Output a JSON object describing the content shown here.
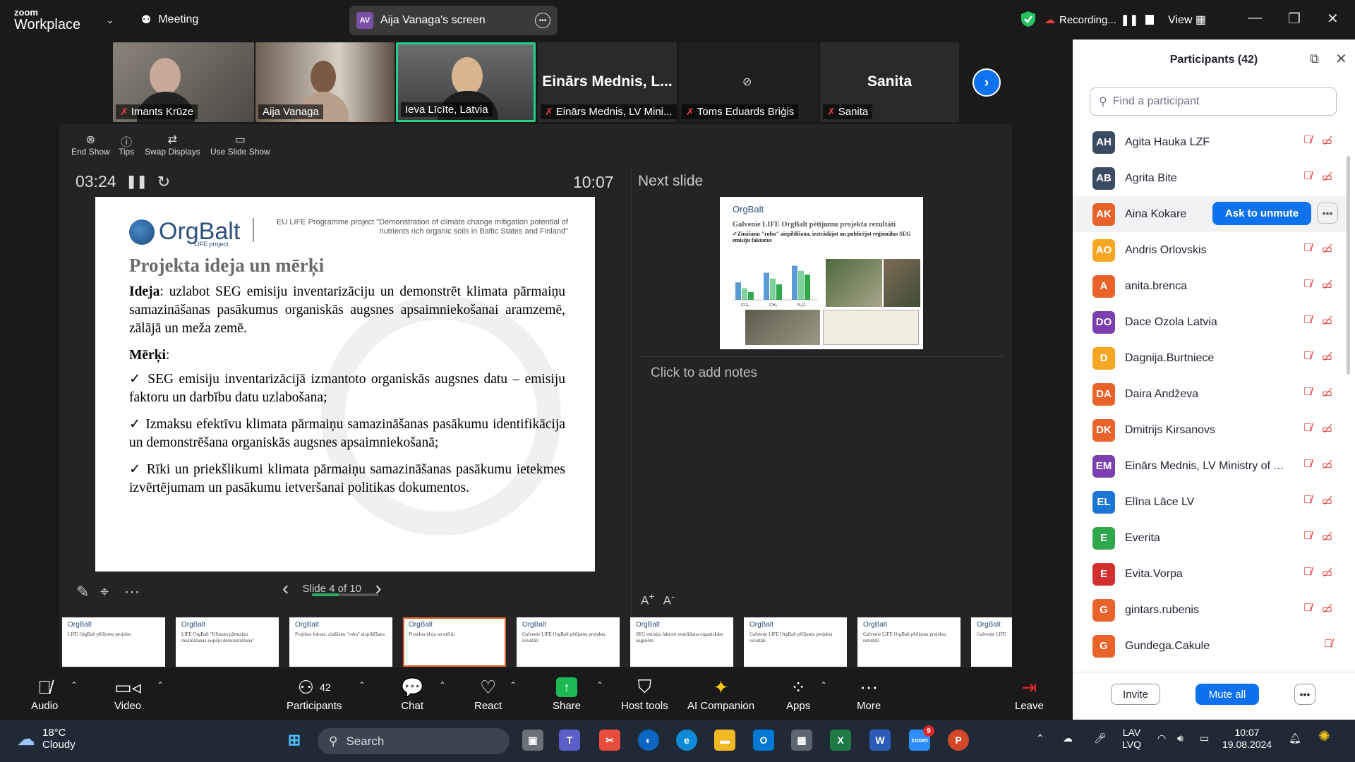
{
  "app": {
    "logo_small": "zoom",
    "logo_big": "Workplace",
    "meeting_label": "Meeting",
    "share_initials": "AV",
    "share_label": "Aija Vanaga's screen",
    "recording_label": "Recording...",
    "view_label": "View"
  },
  "gallery": [
    {
      "name": "Imants Krūze",
      "muted": true,
      "video": true
    },
    {
      "name": "Aija Vanaga",
      "muted": false,
      "video": true
    },
    {
      "name": "Ieva Līcīte, Latvia",
      "muted": false,
      "video": true,
      "active": true
    },
    {
      "name": "Einārs Mednis, LV Mini...",
      "big": "Einārs Mednis, L...",
      "muted": true,
      "video": false
    },
    {
      "name": "Toms Eduards Briģis",
      "muted": true,
      "video": false,
      "cam_off": true
    },
    {
      "name": "Sanita",
      "big": "Sanita",
      "muted": true,
      "video": false
    }
  ],
  "presenter": {
    "tools": [
      "End Show",
      "Tips",
      "Swap Displays",
      "Use Slide Show"
    ],
    "timer": "03:24",
    "clock": "10:07",
    "next_label": "Next slide",
    "notes_placeholder": "Click to add notes",
    "slide_counter": "Slide 4 of 10",
    "progress": 0.4
  },
  "slide": {
    "logo_text": "OrgBalt",
    "logo_sub": "LIFE project",
    "program": "EU LIFE Programme project \"Demonstration of climate change mitigation potential of nutrients rich organic soils in Baltic States and Finland\"",
    "title": "Projekta ideja un mērķi",
    "idea_label": "Ideja",
    "idea_text": ": uzlabot SEG emisiju inventarizāciju un demonstrēt klimata pārmaiņu samazināšanas pasākumus organiskās augsnes apsaimniekošanai aramzemē, zālājā un meža zemē.",
    "goals_label": "Mērķi",
    "goals": [
      "SEG emisiju inventarizācijā izmantoto organiskās augsnes datu – emisiju faktoru un darbību datu uzlabošana;",
      "Izmaksu efektīvu klimata pārmaiņu samazināšanas pasākumu identifikācija un demonstrēšana organiskās augsnes apsaimniekošanā;",
      "Rīki un priekšlikumi klimata pārmaiņu samazināšanas pasākumu ietekmes izvērtējumam un pasākumu ietveršanai politikas dokumentos."
    ]
  },
  "next_slide": {
    "logo_text": "OrgBalt",
    "title": "Galvenie LIFE OrgBalt pētījumu projekta rezultāti",
    "bullet": "✓Zināšanu \"robu\" aizpildīšana, izstrādājot un publicējot reģionālus SEG emisiju faktorus",
    "chart_labels": [
      "CO₂",
      "CH₄",
      "N₂O"
    ],
    "chart_values": [
      [
        45,
        70,
        88
      ],
      [
        30,
        55,
        75
      ],
      [
        20,
        40,
        65
      ]
    ]
  },
  "thumbnails": [
    "LIFE OrgBalt pētījumu projekts",
    "LIFE OrgBalt \"Klimata pārmaiņu mazināšanas iespēju demonstrēšana\"",
    "Projekta fokuss: zināšanu \"robu\" aizpildīšana",
    "Projekta ideja un mērķi",
    "Galvenie LIFE OrgBalt pētījumu projekta rezultāti",
    "SEG emisiju faktoru noteikšana organiskām augsnēm",
    "Galvenie LIFE OrgBalt pētījumu projekta rezultāti",
    "Galvenie LIFE OrgBalt pētījumu projekta rezultāti",
    "Galvenie LIFE"
  ],
  "participants": {
    "title": "Participants (42)",
    "search_placeholder": "Find a participant",
    "ask_unmute": "Ask to unmute",
    "list": [
      {
        "initials": "AH",
        "name": "Agita Hauka LZF",
        "color": "#3b4a63"
      },
      {
        "initials": "AB",
        "name": "Agrita Bite",
        "color": "#3b4a63"
      },
      {
        "initials": "AK",
        "name": "Aina Kokare",
        "color": "#e8622a",
        "highlight": true
      },
      {
        "initials": "AO",
        "name": "Andris Orlovskis",
        "color": "#f5a623"
      },
      {
        "initials": "A",
        "name": "anita.brenca",
        "color": "#e8622a"
      },
      {
        "initials": "DO",
        "name": "Dace Ozola Latvia",
        "color": "#7b3fb0"
      },
      {
        "initials": "D",
        "name": "Dagnija.Burtniece",
        "color": "#f5a623"
      },
      {
        "initials": "DA",
        "name": "Daira Andževa",
        "color": "#e8622a"
      },
      {
        "initials": "DK",
        "name": "Dmitrijs Kirsanovs",
        "color": "#e8622a"
      },
      {
        "initials": "EM",
        "name": "Einārs Mednis, LV Ministry of Ag...",
        "color": "#7b3fb0"
      },
      {
        "initials": "EL",
        "name": "Elīna Lāce LV",
        "color": "#1976d2"
      },
      {
        "initials": "E",
        "name": "Everita",
        "color": "#2ea84a"
      },
      {
        "initials": "E",
        "name": "Evita.Vorpa",
        "color": "#d32f2f"
      },
      {
        "initials": "G",
        "name": "gintars.rubenis",
        "color": "#e8622a"
      },
      {
        "initials": "G",
        "name": "Gundega.Cakule",
        "color": "#e8622a",
        "no_video_icon": true
      }
    ],
    "invite": "Invite",
    "mute_all": "Mute all"
  },
  "controls": {
    "audio": "Audio",
    "video": "Video",
    "participants": "Participants",
    "participants_count": "42",
    "chat": "Chat",
    "react": "React",
    "share": "Share",
    "host_tools": "Host tools",
    "ai": "AI Companion",
    "apps": "Apps",
    "more": "More",
    "leave": "Leave"
  },
  "taskbar": {
    "temp": "18°C",
    "weather": "Cloudy",
    "search": "Search",
    "lang1": "LAV",
    "lang2": "LVQ",
    "time": "10:07",
    "date": "19.08.2024",
    "zoom_badge": "9"
  }
}
